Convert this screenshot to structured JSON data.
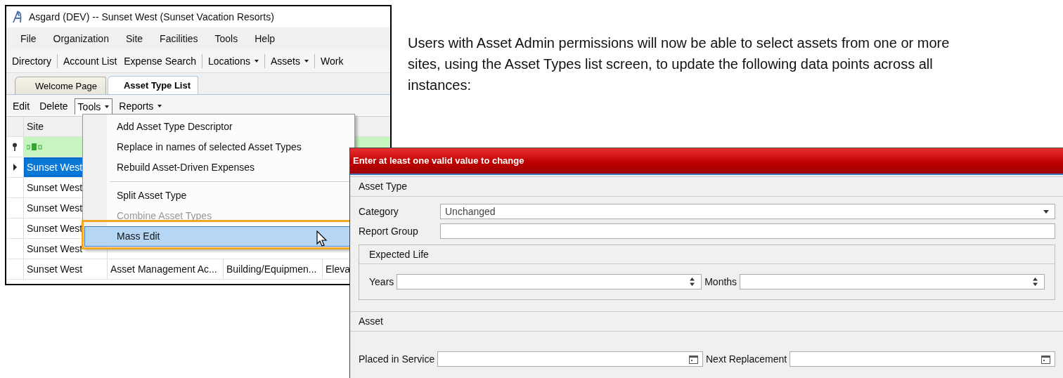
{
  "app_window": {
    "title": "Asgard (DEV) -- Sunset West (Sunset Vacation Resorts)",
    "menu": [
      "File",
      "Organization",
      "Site",
      "Facilities",
      "Tools",
      "Help"
    ],
    "toolbar": [
      {
        "label": "Directory",
        "dropdown": false,
        "separator_before": false
      },
      {
        "label": "Account List",
        "dropdown": false,
        "separator_before": true
      },
      {
        "label": "Expense Search",
        "dropdown": false,
        "separator_before": false
      },
      {
        "label": "Locations",
        "dropdown": true,
        "separator_before": true
      },
      {
        "label": "Assets",
        "dropdown": true,
        "separator_before": true
      },
      {
        "label": "Work",
        "dropdown": false,
        "separator_before": true
      }
    ],
    "tabs": [
      {
        "label": "Welcome Page",
        "selected": false
      },
      {
        "label": "Asset Type List",
        "selected": true
      }
    ],
    "actions": [
      {
        "label": "Edit",
        "dropdown": false,
        "open": false
      },
      {
        "label": "Delete",
        "dropdown": false,
        "open": false
      },
      {
        "label": "Tools",
        "dropdown": true,
        "open": true
      },
      {
        "label": "Reports",
        "dropdown": true,
        "open": false
      }
    ],
    "grid": {
      "columns": [
        "Site"
      ],
      "rows": [
        {
          "cells": [
            "Sunset West"
          ],
          "selected": true
        },
        {
          "cells": [
            "Sunset West"
          ],
          "selected": false
        },
        {
          "cells": [
            "Sunset West"
          ],
          "selected": false
        },
        {
          "cells": [
            "Sunset West"
          ],
          "selected": false
        },
        {
          "cells": [
            "Sunset West"
          ],
          "selected": false
        },
        {
          "cells": [
            "Sunset West",
            "Asset Management Ac...",
            "Building/Equipmen...",
            "Eleva"
          ],
          "selected": false
        }
      ]
    },
    "tools_menu": [
      {
        "kind": "item",
        "label": "Add Asset Type Descriptor",
        "disabled": false,
        "selected": false
      },
      {
        "kind": "item",
        "label": "Replace in names of selected Asset Types",
        "disabled": false,
        "selected": false
      },
      {
        "kind": "item",
        "label": "Rebuild Asset-Driven Expenses",
        "disabled": false,
        "selected": false
      },
      {
        "kind": "separator"
      },
      {
        "kind": "item",
        "label": "Split Asset Type",
        "disabled": false,
        "selected": false
      },
      {
        "kind": "item",
        "label": "Combine Asset Types",
        "disabled": true,
        "selected": false
      },
      {
        "kind": "item",
        "label": "Mass Edit",
        "disabled": false,
        "selected": true
      }
    ]
  },
  "description": "Users with Asset Admin permissions will now be able to select assets from one or more sites, using the Asset Types list screen, to update the following data points across all instances:",
  "dialog": {
    "banner": "Enter at least one valid value to change",
    "sections": [
      {
        "title": "Asset Type",
        "rows": [
          {
            "kind": "single",
            "fields": [
              {
                "label": "Category",
                "kind": "dropdown",
                "value": "Unchanged"
              }
            ]
          },
          {
            "kind": "single",
            "fields": [
              {
                "label": "Report Group",
                "kind": "text"
              }
            ]
          },
          {
            "kind": "group",
            "title": "Expected Life",
            "fields": [
              {
                "label": "Years",
                "kind": "spinner"
              },
              {
                "label": "Months",
                "kind": "spinner"
              }
            ]
          }
        ]
      },
      {
        "title": "Asset",
        "rows": [
          {
            "kind": "pair",
            "fields": [
              {
                "label": "Placed in Service",
                "kind": "date"
              },
              {
                "label": "Next Replacement",
                "kind": "date"
              }
            ]
          }
        ]
      }
    ]
  }
}
